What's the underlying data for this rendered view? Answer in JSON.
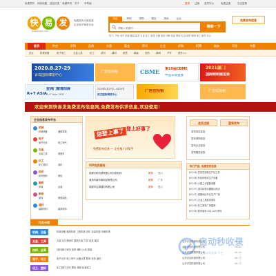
{
  "topbar": {
    "links": [
      "免费发布",
      "网站地图",
      "信息分类",
      "收藏本页",
      "关于",
      "手机版"
    ],
    "right": [
      "登录",
      "注册",
      "会员中心",
      "免费注册",
      "忘记密码"
    ]
  },
  "logo": {
    "chars": [
      "快",
      "易",
      "发"
    ],
    "url": "www.kuaiyi.com"
  },
  "slogan": [
    "免费发布分类信息",
    "企业电子商务平台"
  ],
  "search": {
    "tabs": [
      "供应",
      "采购",
      "求购",
      "展会",
      "资讯",
      "企业"
    ],
    "active_tab": 0,
    "placeholder": "请输入关键词",
    "button": "搜索一下"
  },
  "hot": "热门: 汽车 电子 机械 服装 建材 五金 化工 家居 仪器 食品 印刷 包装 物流 礼品 安防 照明 电工 医药 办公",
  "post_button": "免费发布信息",
  "nav": {
    "items": [
      "首页",
      "供应",
      "采购",
      "品牌",
      "分类",
      "展会",
      "资讯",
      "企业",
      "求购",
      "招聘",
      "商务",
      "问答",
      "专题"
    ],
    "active": 0
  },
  "subnav": [
    "农业",
    "机械设备",
    "电子电工",
    "五金工具",
    "化工",
    "纺织",
    "建材",
    "家居",
    "服装",
    "安防",
    "照明",
    "汽车",
    "更多>>"
  ],
  "banners": [
    {
      "date": "2020.8.27-29",
      "text": "青岛国际博览中心"
    },
    {
      "text": "广告位招租"
    },
    {
      "logo": "CBME",
      "title": "第19届CBME",
      "sub": "中国孕婴童展"
    },
    {
      "title": "2021厦门",
      "sub": "国际照明展览会"
    },
    {
      "logo": "R+T ASIA",
      "title": "亚洲门窗遮阳展",
      "sub": "R+T Asia 2021"
    },
    {
      "text": "2020年4月23日—4月25日",
      "sub": "武汉国际博览中心"
    },
    {
      "title": "广告位招租"
    },
    {
      "text": "广告位招租"
    }
  ],
  "ticker": "欢迎来到快易发免费发布信息网,免费发布供求信息,欢迎使用!",
  "left_panel": {
    "title": "企业信息发布平台",
    "cats": [
      {
        "name": "机械",
        "sub": [
          "机械设备",
          "通用机械",
          "工程机械"
        ]
      },
      {
        "name": "电子",
        "sub": [
          "电子元件",
          "电工电气",
          "仪器仪表"
        ]
      },
      {
        "name": "五金",
        "sub": [
          "五金工具",
          "紧固件",
          "建筑五金"
        ]
      },
      {
        "name": "化工",
        "sub": [
          "化工原料",
          "涂料",
          "塑料橡胶"
        ]
      },
      {
        "name": "纺织",
        "sub": [
          "纺织面料",
          "家纺",
          "皮革"
        ]
      },
      {
        "name": "服装",
        "sub": [
          "男装",
          "女装",
          "童装"
        ]
      },
      {
        "name": "家居",
        "sub": [
          "家具",
          "家居用品",
          "厨具"
        ]
      },
      {
        "name": "建材",
        "sub": [
          "建筑材料",
          "装饰材料",
          "门窗"
        ]
      }
    ]
  },
  "center_banner": {
    "line1": "您登上事了",
    "line2": "登上好事了",
    "caption": "免费发布信息 — 企业推广好帮手"
  },
  "vip": {
    "title": "VIP会员服务",
    "rows": [
      {
        "name": "成都分析机械有限公司分析机械",
        "tag": "推荐",
        "area": "四川",
        "desc": "供应分析仪器"
      },
      {
        "name": "深圳市鑫华美科技有限公司",
        "tag": "推荐",
        "area": "广东",
        "desc": "电子元器件"
      },
      {
        "name": "成都市吉源建材有限公司",
        "tag": "推荐",
        "area": "四川",
        "desc": "建筑材料"
      }
    ]
  },
  "right_box": {
    "buttons": [
      "会员注册",
      "登录发布"
    ],
    "links": [
      "发布供应信息",
      "发布求购信息",
      "发布企业信息",
      "发布展会信息"
    ]
  },
  "right_news": {
    "title": "热门产品, 免费发布信息",
    "items": [
      {
        "text": "[05-08] 豆浆豆奶粉生产加工机",
        "date": ""
      },
      {
        "text": "[05-08] 氧化锌粉末生产设备",
        "date": ""
      },
      {
        "text": "[05-08] 大型工业智能设备",
        "date": ""
      },
      {
        "text": "[05-07] 进口精密仪器报价供应",
        "date": ""
      },
      {
        "text": "[05-07] 成都地区专业生产厂家",
        "date": ""
      },
      {
        "text": "[05-07] 五金工具批发零售",
        "date": ""
      },
      {
        "text": "[05-06] 化工原料厂家直销",
        "date": ""
      },
      {
        "text": "[05-06] 纺织面料 ACF ACE 布料",
        "date": ""
      }
    ]
  },
  "bottom": {
    "title": "行业分类",
    "rows": [
      {
        "tag": "机械、设备",
        "items": "机械设备 通用机械 工程机械 农机 包装机械 印刷机械"
      },
      {
        "tag": "五金、工具",
        "items": "五金工具 紧固件 建筑五金 刃具 量具 磨具"
      },
      {
        "tag": "纺织、皮革",
        "items": "纺织面料 家纺 皮革 辅料 纱线 服装"
      },
      {
        "tag": "电子、电工",
        "items": "电子元件 电工电气 仪器仪表 照明 安防 通讯"
      },
      {
        "tag": "化工、塑料",
        "items": "化工原料 涂料 塑料 橡胶 精细化工"
      }
    ],
    "right_items": [
      {
        "text": "山东青岛机械有限公司",
        "date": "06-18"
      },
      {
        "text": "山东青岛机械有限公司",
        "date": "06-18"
      },
      {
        "text": "山东青岛机械有限公司",
        "date": "06-18"
      },
      {
        "text": "山东青岛机械有限公司",
        "date": "06-17"
      },
      {
        "text": "山东青岛机械有限公司",
        "date": "06-17"
      }
    ]
  },
  "watermark": {
    "brand": "自动秒收录",
    "sub": "全自动秒收录 平台"
  },
  "colors": {
    "accent": "#f08000",
    "nav": "#f08000",
    "active": "#d92a0a",
    "ticker": "#b31212"
  }
}
